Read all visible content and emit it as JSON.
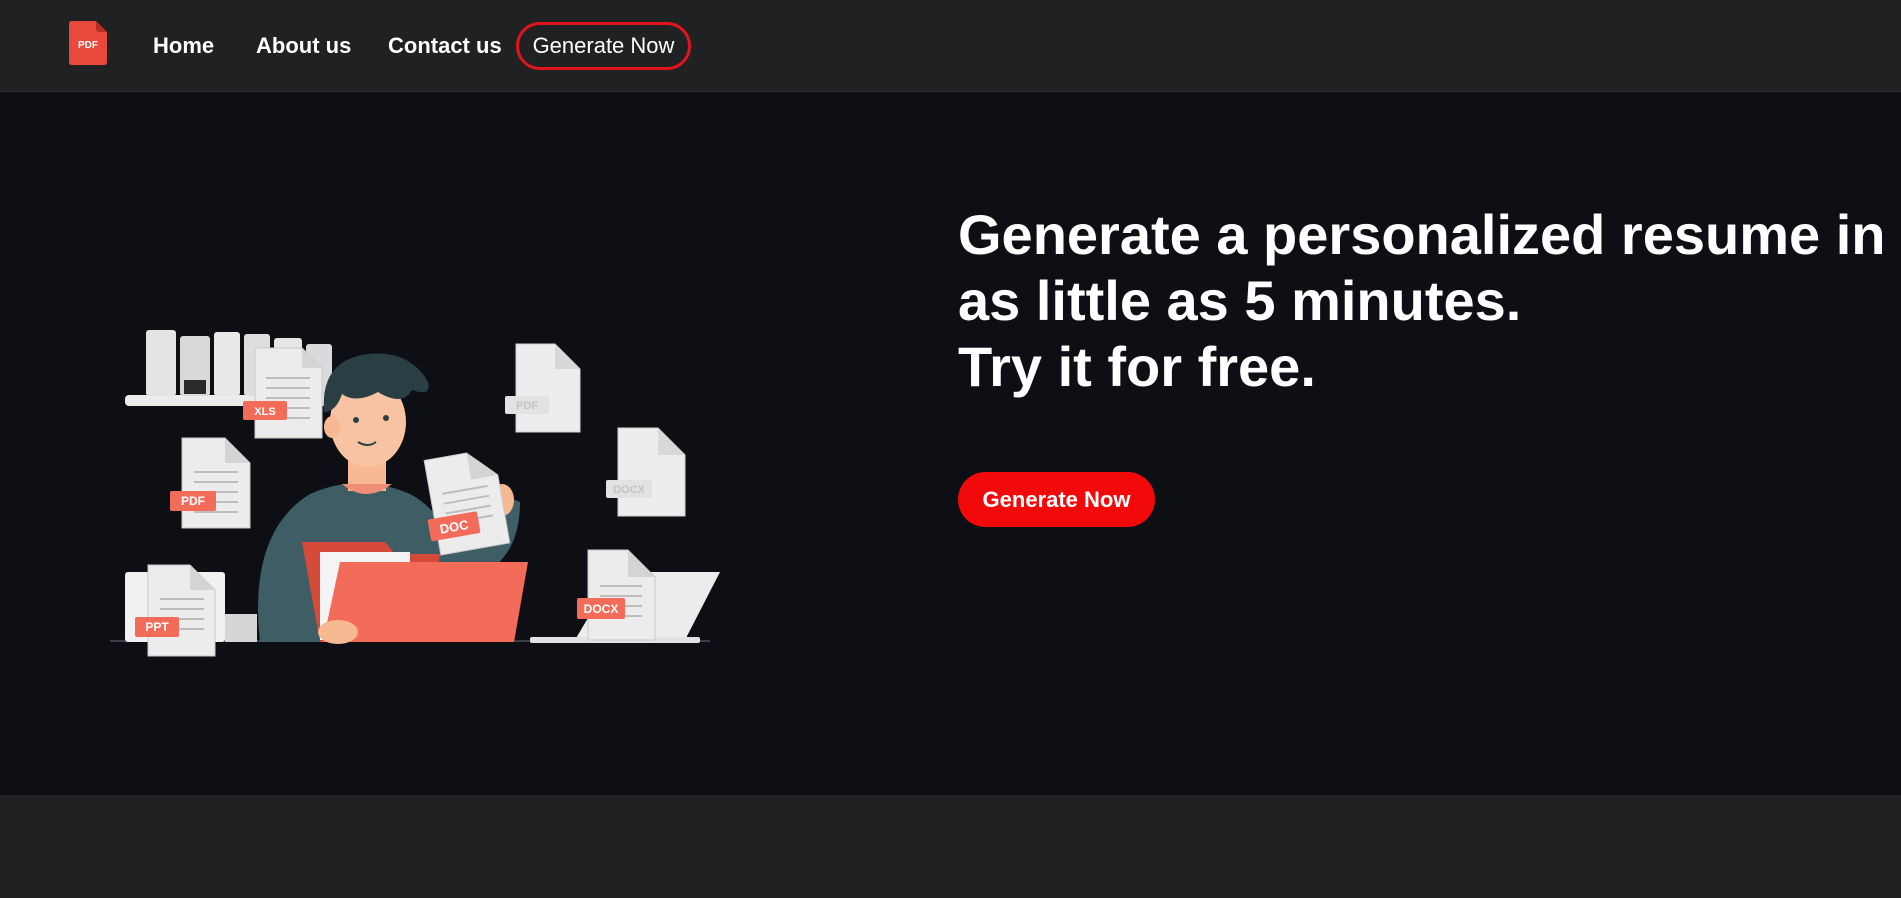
{
  "nav": {
    "logo_text": "PDF",
    "links": [
      {
        "label": "Home"
      },
      {
        "label": "About us"
      },
      {
        "label": "Contact us"
      }
    ],
    "generate_label": "Generate Now"
  },
  "hero": {
    "headline_line1": "Generate a personalized resume in",
    "headline_line2": "as little as 5 minutes.",
    "headline_line3": "Try it for free.",
    "cta_label": "Generate Now",
    "illustration_tags": [
      "XLS",
      "PDF",
      "PDF",
      "DOC",
      "DOCX",
      "PPT",
      "DOCX"
    ]
  },
  "colors": {
    "navbar_bg": "#202123",
    "hero_bg": "#0d0f15",
    "accent_red": "#f20a0a",
    "tag_orange": "#f36c5a"
  }
}
